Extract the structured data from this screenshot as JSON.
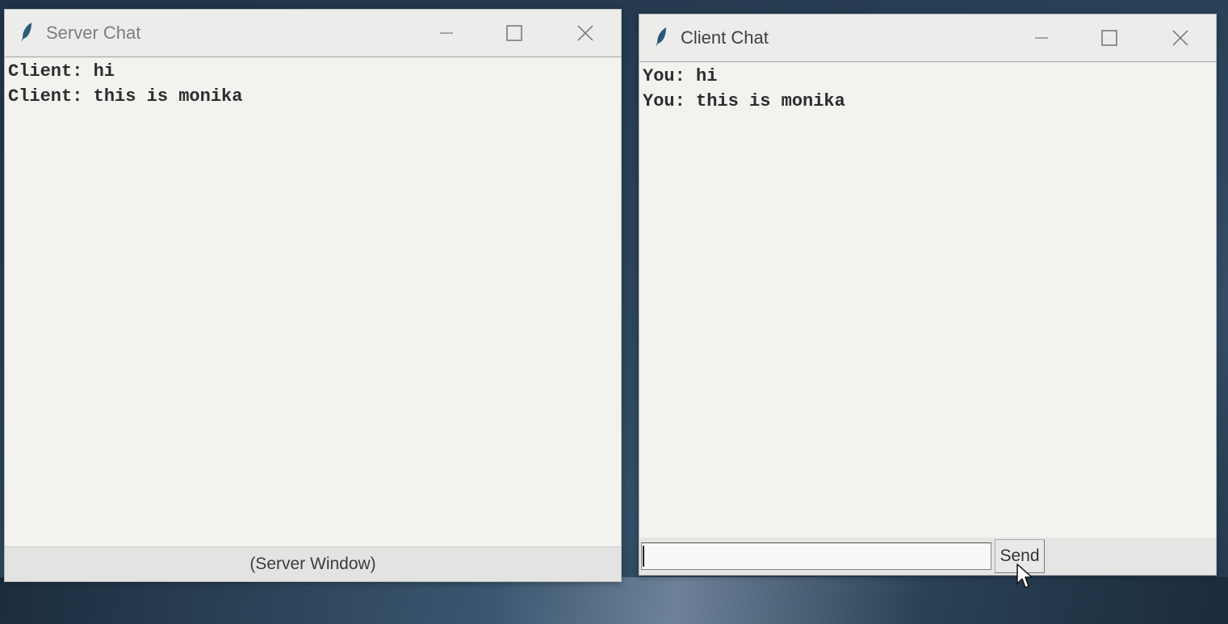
{
  "server": {
    "title": "Server Chat",
    "messages": [
      "Client: hi",
      "Client: this is monika"
    ],
    "status_label": "(Server Window)"
  },
  "client": {
    "title": "Client Chat",
    "messages": [
      "You: hi",
      "You: this is monika"
    ],
    "input_value": "",
    "send_label": "Send"
  },
  "icons": {
    "app_icon": "feather-icon",
    "minimize": "minimize-icon",
    "maximize": "maximize-icon",
    "close": "close-icon",
    "cursor": "mouse-pointer-icon"
  },
  "colors": {
    "window_bg": "#f0f0ee",
    "feather": "#2a5a7a"
  }
}
